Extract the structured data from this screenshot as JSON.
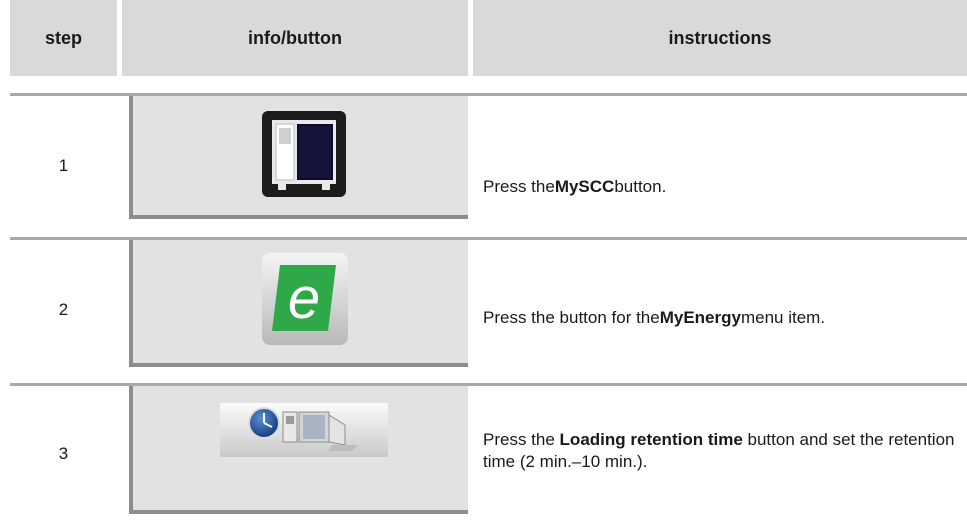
{
  "header": {
    "step": "step",
    "info": "info/button",
    "instructions": "instructions"
  },
  "rows": [
    {
      "step": "1",
      "icon": "myscc-oven-icon",
      "instruction_pre": "Press the ",
      "instruction_bold": "MySCC",
      "instruction_post": " button."
    },
    {
      "step": "2",
      "icon": "myenergy-e-icon",
      "instruction_pre": "Press the button for the ",
      "instruction_bold": "MyEnergy",
      "instruction_post": " menu item."
    },
    {
      "step": "3",
      "icon": "loading-retention-time-icon",
      "instruction_pre": "Press the ",
      "instruction_bold": "Loading retention time",
      "instruction_post": " button and set the retention time (2 min.–10 min.)."
    }
  ],
  "colors": {
    "header_bg": "#d9d9d9",
    "panel_bg": "#e2e2e2",
    "separator": "#a8a8a8",
    "energy_green": "#2fa84a"
  }
}
